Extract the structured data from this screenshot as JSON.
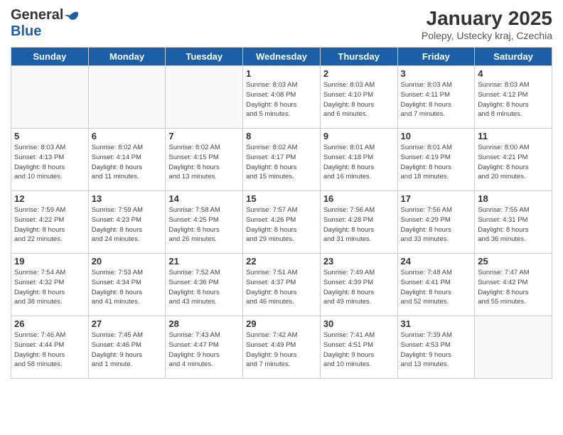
{
  "header": {
    "logo_general": "General",
    "logo_blue": "Blue",
    "month_title": "January 2025",
    "location": "Polepy, Ustecky kraj, Czechia"
  },
  "weekdays": [
    "Sunday",
    "Monday",
    "Tuesday",
    "Wednesday",
    "Thursday",
    "Friday",
    "Saturday"
  ],
  "weeks": [
    [
      {
        "day": "",
        "info": ""
      },
      {
        "day": "",
        "info": ""
      },
      {
        "day": "",
        "info": ""
      },
      {
        "day": "1",
        "info": "Sunrise: 8:03 AM\nSunset: 4:08 PM\nDaylight: 8 hours\nand 5 minutes."
      },
      {
        "day": "2",
        "info": "Sunrise: 8:03 AM\nSunset: 4:10 PM\nDaylight: 8 hours\nand 6 minutes."
      },
      {
        "day": "3",
        "info": "Sunrise: 8:03 AM\nSunset: 4:11 PM\nDaylight: 8 hours\nand 7 minutes."
      },
      {
        "day": "4",
        "info": "Sunrise: 8:03 AM\nSunset: 4:12 PM\nDaylight: 8 hours\nand 8 minutes."
      }
    ],
    [
      {
        "day": "5",
        "info": "Sunrise: 8:03 AM\nSunset: 4:13 PM\nDaylight: 8 hours\nand 10 minutes."
      },
      {
        "day": "6",
        "info": "Sunrise: 8:02 AM\nSunset: 4:14 PM\nDaylight: 8 hours\nand 11 minutes."
      },
      {
        "day": "7",
        "info": "Sunrise: 8:02 AM\nSunset: 4:15 PM\nDaylight: 8 hours\nand 13 minutes."
      },
      {
        "day": "8",
        "info": "Sunrise: 8:02 AM\nSunset: 4:17 PM\nDaylight: 8 hours\nand 15 minutes."
      },
      {
        "day": "9",
        "info": "Sunrise: 8:01 AM\nSunset: 4:18 PM\nDaylight: 8 hours\nand 16 minutes."
      },
      {
        "day": "10",
        "info": "Sunrise: 8:01 AM\nSunset: 4:19 PM\nDaylight: 8 hours\nand 18 minutes."
      },
      {
        "day": "11",
        "info": "Sunrise: 8:00 AM\nSunset: 4:21 PM\nDaylight: 8 hours\nand 20 minutes."
      }
    ],
    [
      {
        "day": "12",
        "info": "Sunrise: 7:59 AM\nSunset: 4:22 PM\nDaylight: 8 hours\nand 22 minutes."
      },
      {
        "day": "13",
        "info": "Sunrise: 7:59 AM\nSunset: 4:23 PM\nDaylight: 8 hours\nand 24 minutes."
      },
      {
        "day": "14",
        "info": "Sunrise: 7:58 AM\nSunset: 4:25 PM\nDaylight: 8 hours\nand 26 minutes."
      },
      {
        "day": "15",
        "info": "Sunrise: 7:57 AM\nSunset: 4:26 PM\nDaylight: 8 hours\nand 29 minutes."
      },
      {
        "day": "16",
        "info": "Sunrise: 7:56 AM\nSunset: 4:28 PM\nDaylight: 8 hours\nand 31 minutes."
      },
      {
        "day": "17",
        "info": "Sunrise: 7:56 AM\nSunset: 4:29 PM\nDaylight: 8 hours\nand 33 minutes."
      },
      {
        "day": "18",
        "info": "Sunrise: 7:55 AM\nSunset: 4:31 PM\nDaylight: 8 hours\nand 36 minutes."
      }
    ],
    [
      {
        "day": "19",
        "info": "Sunrise: 7:54 AM\nSunset: 4:32 PM\nDaylight: 8 hours\nand 38 minutes."
      },
      {
        "day": "20",
        "info": "Sunrise: 7:53 AM\nSunset: 4:34 PM\nDaylight: 8 hours\nand 41 minutes."
      },
      {
        "day": "21",
        "info": "Sunrise: 7:52 AM\nSunset: 4:36 PM\nDaylight: 8 hours\nand 43 minutes."
      },
      {
        "day": "22",
        "info": "Sunrise: 7:51 AM\nSunset: 4:37 PM\nDaylight: 8 hours\nand 46 minutes."
      },
      {
        "day": "23",
        "info": "Sunrise: 7:49 AM\nSunset: 4:39 PM\nDaylight: 8 hours\nand 49 minutes."
      },
      {
        "day": "24",
        "info": "Sunrise: 7:48 AM\nSunset: 4:41 PM\nDaylight: 8 hours\nand 52 minutes."
      },
      {
        "day": "25",
        "info": "Sunrise: 7:47 AM\nSunset: 4:42 PM\nDaylight: 8 hours\nand 55 minutes."
      }
    ],
    [
      {
        "day": "26",
        "info": "Sunrise: 7:46 AM\nSunset: 4:44 PM\nDaylight: 8 hours\nand 58 minutes."
      },
      {
        "day": "27",
        "info": "Sunrise: 7:45 AM\nSunset: 4:46 PM\nDaylight: 9 hours\nand 1 minute."
      },
      {
        "day": "28",
        "info": "Sunrise: 7:43 AM\nSunset: 4:47 PM\nDaylight: 9 hours\nand 4 minutes."
      },
      {
        "day": "29",
        "info": "Sunrise: 7:42 AM\nSunset: 4:49 PM\nDaylight: 9 hours\nand 7 minutes."
      },
      {
        "day": "30",
        "info": "Sunrise: 7:41 AM\nSunset: 4:51 PM\nDaylight: 9 hours\nand 10 minutes."
      },
      {
        "day": "31",
        "info": "Sunrise: 7:39 AM\nSunset: 4:53 PM\nDaylight: 9 hours\nand 13 minutes."
      },
      {
        "day": "",
        "info": ""
      }
    ]
  ]
}
